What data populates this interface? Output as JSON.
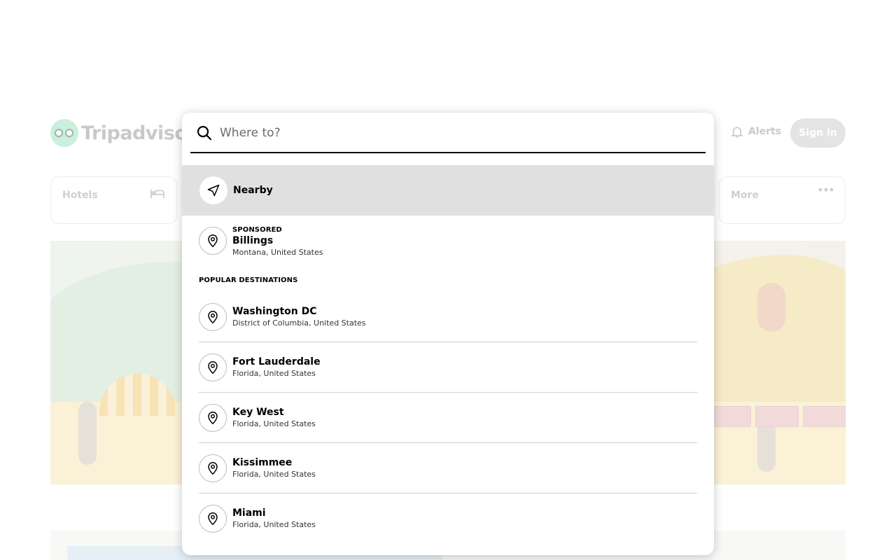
{
  "header": {
    "logo_text": "Tripadvisor",
    "alerts_label": "Alerts",
    "signin_label": "Sign in"
  },
  "categories": {
    "hotels_label": "Hotels",
    "more_label": "More"
  },
  "search": {
    "placeholder": "Where to?",
    "value": "",
    "nearby_label": "Nearby"
  },
  "sponsored": {
    "tag": "SPONSORED",
    "name": "Billings",
    "location": "Montana, United States"
  },
  "popular": {
    "title": "POPULAR DESTINATIONS",
    "items": [
      {
        "name": "Washington DC",
        "location": "District of Columbia, United States"
      },
      {
        "name": "Fort Lauderdale",
        "location": "Florida, United States"
      },
      {
        "name": "Key West",
        "location": "Florida, United States"
      },
      {
        "name": "Kissimmee",
        "location": "Florida, United States"
      },
      {
        "name": "Miami",
        "location": "Florida, United States"
      }
    ]
  },
  "icons": {
    "search": "search-icon",
    "nearby": "navigation-arrow-icon",
    "destination": "map-pin-icon",
    "bell": "bell-icon",
    "bed": "bed-icon",
    "more": "ellipsis-icon"
  },
  "colors": {
    "nearby_highlight": "#e0e0e0",
    "divider": "#cfcfcf",
    "signin_bg": "#e4e4e4"
  }
}
